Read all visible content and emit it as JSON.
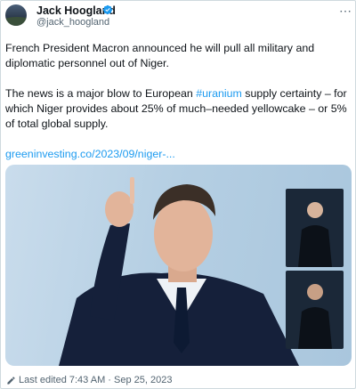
{
  "tweet": {
    "author_name": "Jack Hoogland",
    "author_handle": "@jack_hoogland",
    "more_label": "⋯",
    "para1": "French President Macron announced he will pull all military and diplomatic personnel out of Niger.",
    "para2_before": "The news is a major blow to European ",
    "para2_hashtag": "#uranium",
    "para2_after": " supply certainty – for which Niger provides about 25% of much–needed yellowcake – or 5% of total global supply.",
    "link_text": "greeninvesting.co/2023/09/niger-...",
    "footer_text": "Last edited 7:43 AM · Sep 25, 2023"
  },
  "icons": {
    "verified": "verified-badge-icon",
    "more": "more-options-icon",
    "edit": "pencil-icon"
  },
  "colors": {
    "link": "#1d9bf0",
    "verified": "#1d9bf0",
    "secondary_text": "#536471"
  }
}
